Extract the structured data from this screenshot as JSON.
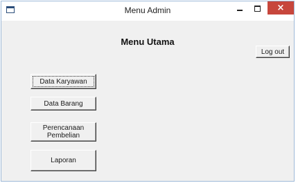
{
  "window": {
    "title": "Menu Admin",
    "close_glyph": "×"
  },
  "main": {
    "heading": "Menu Utama",
    "logout_label": "Log out",
    "buttons": [
      {
        "label": "Data Karyawan"
      },
      {
        "label": "Data Barang"
      },
      {
        "label": "Perencanaan Pembelian"
      },
      {
        "label": "Laporan"
      }
    ]
  },
  "colors": {
    "close_button": "#c7463c",
    "window_bg": "#f0f0f0",
    "border": "#9db9d8"
  },
  "icons": [
    "app-icon",
    "minimize-icon",
    "maximize-icon",
    "close-icon"
  ]
}
